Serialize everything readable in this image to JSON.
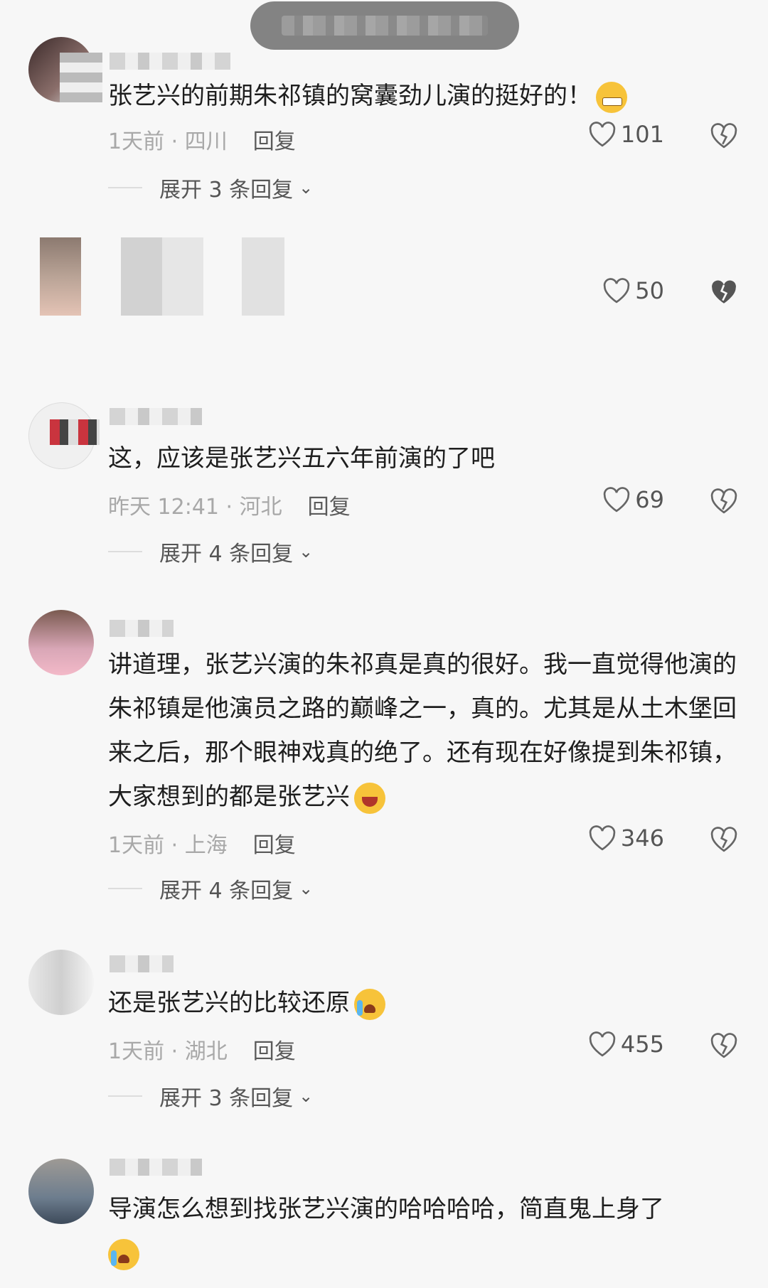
{
  "comments": [
    {
      "text": "张艺兴的前期朱祁镇的窝囊劲儿演的挺好的！",
      "time_location": "1天前 · 四川",
      "reply_label": "回复",
      "likes": "101",
      "expand_label": "展开 3 条回复"
    },
    {
      "likes": "50"
    },
    {
      "text": "这，应该是张艺兴五六年前演的了吧",
      "time_location": "昨天 12:41 · 河北",
      "reply_label": "回复",
      "likes": "69",
      "expand_label": "展开 4 条回复"
    },
    {
      "text": "讲道理，张艺兴演的朱祁真是真的很好。我一直觉得他演的朱祁镇是他演员之路的巅峰之一，真的。尤其是从土木堡回来之后，那个眼神戏真的绝了。还有现在好像提到朱祁镇，大家想到的都是张艺兴",
      "time_location": "1天前 · 上海",
      "reply_label": "回复",
      "likes": "346",
      "expand_label": "展开 4 条回复"
    },
    {
      "text": "还是张艺兴的比较还原",
      "time_location": "1天前 · 湖北",
      "reply_label": "回复",
      "likes": "455",
      "expand_label": "展开 3 条回复"
    },
    {
      "text": "导演怎么想到找张艺兴演的哈哈哈哈，简直鬼上身了"
    }
  ],
  "icons": {
    "like": "heart-outline-icon",
    "dislike": "broken-heart-icon",
    "expand": "chevron-down-icon"
  },
  "colors": {
    "background": "#f7f7f7",
    "meta_text": "#a8a8a8",
    "body_text": "#1e1e1e"
  }
}
